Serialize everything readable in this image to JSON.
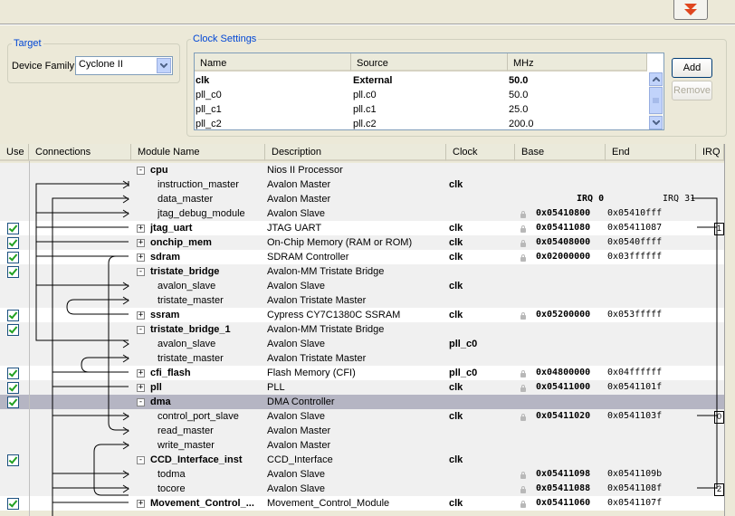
{
  "target": {
    "legend": "Target",
    "device_family_label": "Device Family:",
    "device_family_value": "Cyclone II"
  },
  "clock_settings": {
    "legend": "Clock Settings",
    "headers": [
      "Name",
      "Source",
      "MHz"
    ],
    "rows": [
      {
        "name": "clk",
        "source": "External",
        "mhz": "50.0",
        "bold": true
      },
      {
        "name": "pll_c0",
        "source": "pll.c0",
        "mhz": "50.0",
        "bold": false
      },
      {
        "name": "pll_c1",
        "source": "pll.c1",
        "mhz": "25.0",
        "bold": false
      },
      {
        "name": "pll_c2",
        "source": "pll.c2",
        "mhz": "200.0",
        "bold": false
      }
    ],
    "add_label": "Add",
    "remove_label": "Remove"
  },
  "grid": {
    "headers": [
      "Use",
      "Connections",
      "Module Name",
      "Description",
      "Clock",
      "Base",
      "End",
      "IRQ"
    ],
    "rows": [
      {
        "kind": "module",
        "toggle": "−",
        "use": false,
        "name": "cpu",
        "desc": "Nios II Processor",
        "clock": "",
        "base": "",
        "end": "",
        "irq": "",
        "lock": false,
        "bg": "#f0f0f0"
      },
      {
        "kind": "port",
        "name": "instruction_master",
        "desc": "Avalon Master",
        "clock": "clk",
        "base": "",
        "end": "",
        "irq": "",
        "lock": false,
        "bg": "#f0f0f0"
      },
      {
        "kind": "port",
        "name": "data_master",
        "desc": "Avalon Master",
        "clock": "",
        "base": "IRQ 0",
        "end": "IRQ 31",
        "irq": "",
        "lock": false,
        "bg": "#f0f0f0"
      },
      {
        "kind": "port",
        "name": "jtag_debug_module",
        "desc": "Avalon Slave",
        "clock": "",
        "base": "0x05410800",
        "end": "0x05410fff",
        "irq": "",
        "lock": true,
        "bg": "#f0f0f0"
      },
      {
        "kind": "module",
        "toggle": "+",
        "use": true,
        "name": "jtag_uart",
        "desc": "JTAG UART",
        "clock": "clk",
        "base": "0x05411080",
        "end": "0x05411087",
        "irq": "1",
        "lock": true,
        "bg": "#ffffff"
      },
      {
        "kind": "module",
        "toggle": "+",
        "use": true,
        "name": "onchip_mem",
        "desc": "On-Chip Memory (RAM or ROM)",
        "clock": "clk",
        "base": "0x05408000",
        "end": "0x0540ffff",
        "irq": "",
        "lock": true,
        "bg": "#f0f0f0"
      },
      {
        "kind": "module",
        "toggle": "+",
        "use": true,
        "name": "sdram",
        "desc": "SDRAM Controller",
        "clock": "clk",
        "base": "0x02000000",
        "end": "0x03ffffff",
        "irq": "",
        "lock": true,
        "bg": "#ffffff"
      },
      {
        "kind": "module",
        "toggle": "−",
        "use": true,
        "name": "tristate_bridge",
        "desc": "Avalon-MM Tristate Bridge",
        "clock": "",
        "base": "",
        "end": "",
        "irq": "",
        "lock": false,
        "bg": "#f0f0f0"
      },
      {
        "kind": "port",
        "name": "avalon_slave",
        "desc": "Avalon Slave",
        "clock": "clk",
        "base": "",
        "end": "",
        "irq": "",
        "lock": false,
        "bg": "#f0f0f0"
      },
      {
        "kind": "port",
        "name": "tristate_master",
        "desc": "Avalon Tristate Master",
        "clock": "",
        "base": "",
        "end": "",
        "irq": "",
        "lock": false,
        "bg": "#f0f0f0"
      },
      {
        "kind": "module",
        "toggle": "+",
        "use": true,
        "name": "ssram",
        "desc": "Cypress CY7C1380C SSRAM",
        "clock": "clk",
        "base": "0x05200000",
        "end": "0x053fffff",
        "irq": "",
        "lock": true,
        "bg": "#ffffff"
      },
      {
        "kind": "module",
        "toggle": "−",
        "use": true,
        "name": "tristate_bridge_1",
        "desc": "Avalon-MM Tristate Bridge",
        "clock": "",
        "base": "",
        "end": "",
        "irq": "",
        "lock": false,
        "bg": "#f0f0f0"
      },
      {
        "kind": "port",
        "name": "avalon_slave",
        "desc": "Avalon Slave",
        "clock": "pll_c0",
        "base": "",
        "end": "",
        "irq": "",
        "lock": false,
        "bg": "#f0f0f0"
      },
      {
        "kind": "port",
        "name": "tristate_master",
        "desc": "Avalon Tristate Master",
        "clock": "",
        "base": "",
        "end": "",
        "irq": "",
        "lock": false,
        "bg": "#f0f0f0"
      },
      {
        "kind": "module",
        "toggle": "+",
        "use": true,
        "name": "cfi_flash",
        "desc": "Flash Memory (CFI)",
        "clock": "pll_c0",
        "base": "0x04800000",
        "end": "0x04ffffff",
        "irq": "",
        "lock": true,
        "bg": "#ffffff"
      },
      {
        "kind": "module",
        "toggle": "+",
        "use": true,
        "name": "pll",
        "desc": "PLL",
        "clock": "clk",
        "base": "0x05411000",
        "end": "0x0541101f",
        "irq": "",
        "lock": true,
        "bg": "#f0f0f0"
      },
      {
        "kind": "module",
        "toggle": "−",
        "use": true,
        "name": "dma",
        "desc": "DMA Controller",
        "clock": "",
        "base": "",
        "end": "",
        "irq": "",
        "lock": false,
        "bg": "#b5b5c3"
      },
      {
        "kind": "port",
        "name": "control_port_slave",
        "desc": "Avalon Slave",
        "clock": "clk",
        "base": "0x05411020",
        "end": "0x0541103f",
        "irq": "0",
        "lock": true,
        "bg": "#f0f0f0"
      },
      {
        "kind": "port",
        "name": "read_master",
        "desc": "Avalon Master",
        "clock": "",
        "base": "",
        "end": "",
        "irq": "",
        "lock": false,
        "bg": "#f0f0f0"
      },
      {
        "kind": "port",
        "name": "write_master",
        "desc": "Avalon Master",
        "clock": "",
        "base": "",
        "end": "",
        "irq": "",
        "lock": false,
        "bg": "#f0f0f0"
      },
      {
        "kind": "module",
        "toggle": "−",
        "use": true,
        "name": "CCD_Interface_inst",
        "desc": "CCD_Interface",
        "clock": "clk",
        "base": "",
        "end": "",
        "irq": "",
        "lock": false,
        "bg": "#f0f0f0"
      },
      {
        "kind": "port",
        "name": "todma",
        "desc": "Avalon Slave",
        "clock": "",
        "base": "0x05411098",
        "end": "0x0541109b",
        "irq": "",
        "lock": true,
        "bg": "#f0f0f0"
      },
      {
        "kind": "port",
        "name": "tocore",
        "desc": "Avalon Slave",
        "clock": "",
        "base": "0x05411088",
        "end": "0x0541108f",
        "irq": "2",
        "lock": true,
        "bg": "#f0f0f0"
      },
      {
        "kind": "module",
        "toggle": "+",
        "use": true,
        "name": "Movement_Control_...",
        "desc": "Movement_Control_Module",
        "clock": "clk",
        "base": "0x05411060",
        "end": "0x0541107f",
        "irq": "",
        "lock": true,
        "bg": "#ffffff"
      }
    ]
  }
}
